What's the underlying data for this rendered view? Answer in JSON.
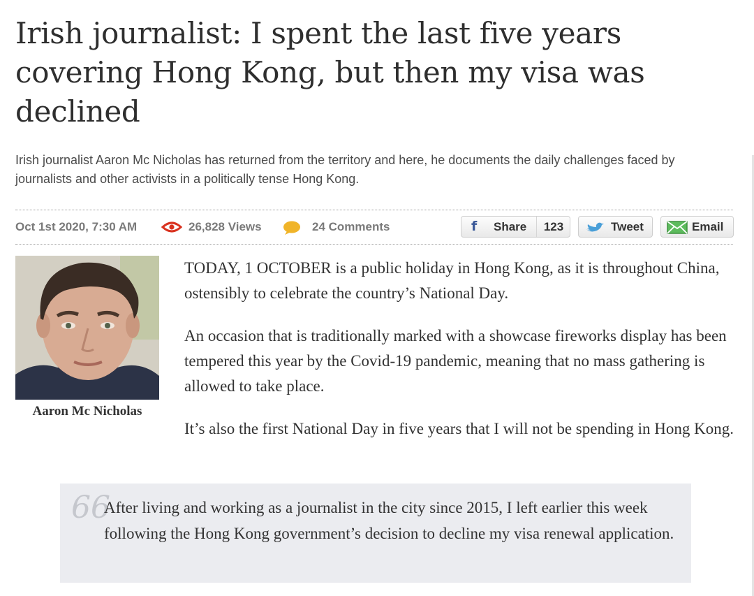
{
  "article": {
    "headline": "Irish journalist: I spent the last five years covering Hong Kong, but then my visa was declined",
    "standfirst": "Irish journalist Aaron Mc Nicholas has returned from the territory and here, he documents the daily challenges faced by journalists and other activists in a politically tense Hong Kong."
  },
  "meta": {
    "date": "Oct 1st 2020, 7:30 AM",
    "views": "26,828 Views",
    "comments": "24 Comments",
    "views_icon": "eye-icon",
    "comments_icon": "speech-bubble-icon"
  },
  "share": {
    "facebook_label": "Share",
    "facebook_count": "123",
    "facebook_icon_glyph": "f",
    "tweet_label": "Tweet",
    "email_label": "Email"
  },
  "author": {
    "name": "Aaron Mc Nicholas"
  },
  "body": {
    "paragraphs": [
      "TODAY, 1 OCTOBER is a public holiday in Hong Kong, as it is throughout China, ostensibly to celebrate the country’s National Day.",
      "An occasion that is traditionally marked with a showcase fireworks display has been tempered this year by the Covid-19 pandemic, meaning that no mass gathering is allowed to take place.",
      "It’s also the first National Day in five years that I will not be spending in Hong Kong."
    ],
    "quote": "After living and working as a journalist in the city since 2015, I left earlier this week following the Hong Kong government’s decision to decline my visa renewal application.",
    "quote_mark": "66"
  },
  "colors": {
    "eye_icon": "#d9321f",
    "comment_bubble": "#f0b429",
    "facebook": "#3b5998",
    "twitter": "#4a9fd8",
    "email": "#4aa84a",
    "quote_background": "#ebecf0"
  }
}
